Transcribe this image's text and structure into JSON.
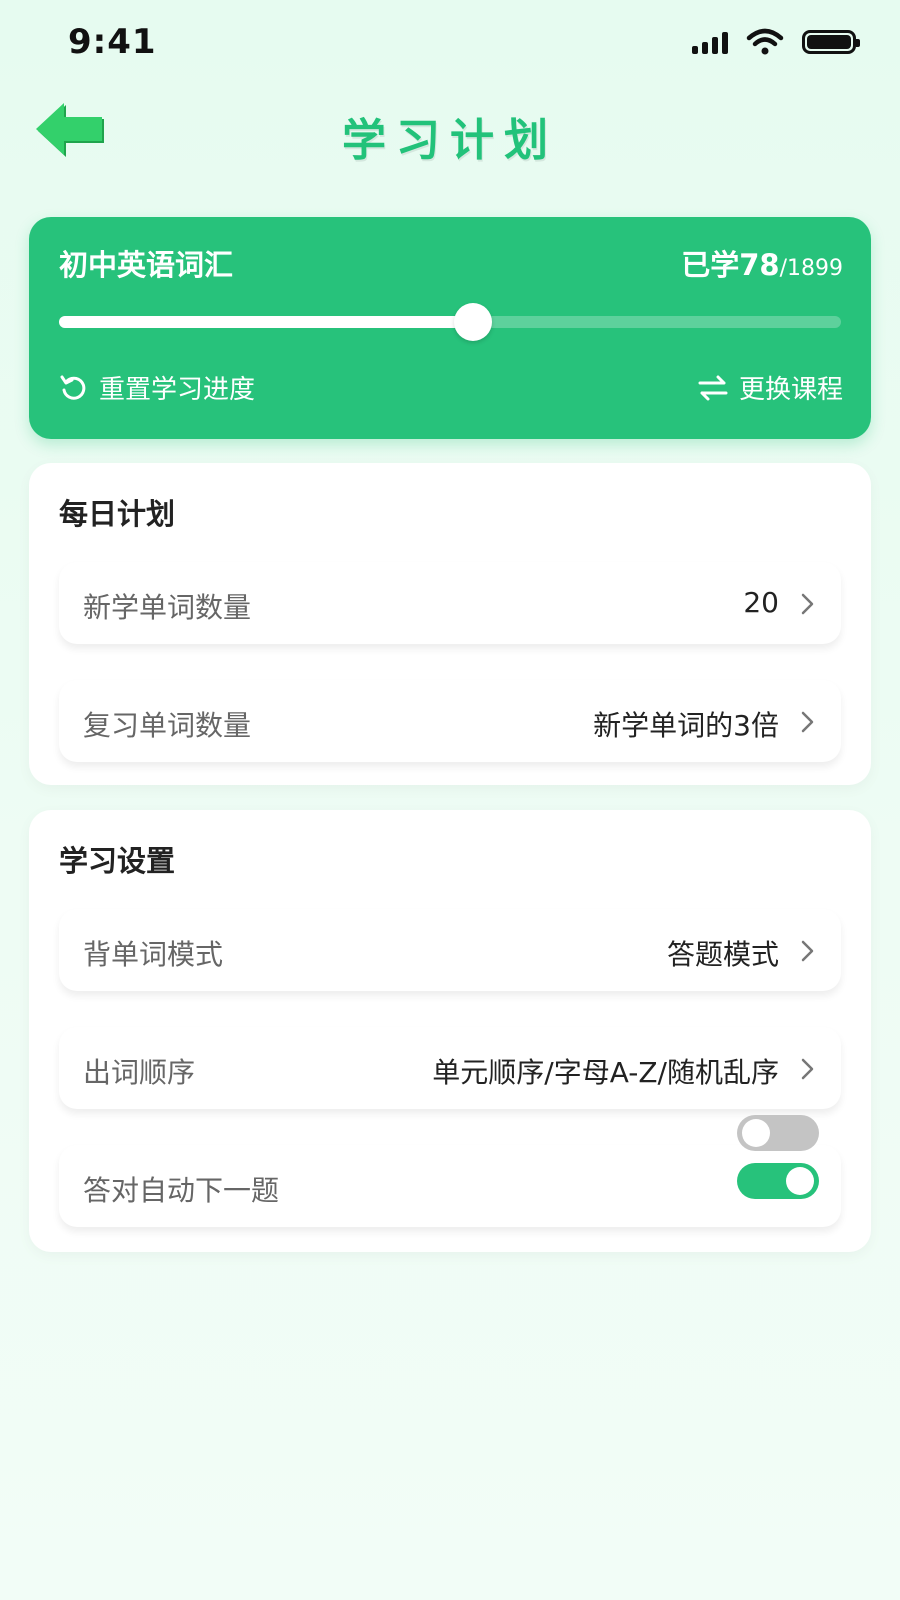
{
  "status_bar": {
    "time": "9:41"
  },
  "header": {
    "title": "学习计划"
  },
  "course": {
    "name": "初中英语词汇",
    "learned_prefix": "已学",
    "learned": "78",
    "total": "/1899",
    "progress_fraction": 0.53,
    "reset_label": "重置学习进度",
    "switch_label": "更换课程"
  },
  "daily_plan": {
    "title": "每日计划",
    "rows": [
      {
        "label": "新学单词数量",
        "value": "20"
      },
      {
        "label": "复习单词数量",
        "value": "新学单词的3倍"
      }
    ]
  },
  "study_settings": {
    "title": "学习设置",
    "rows": [
      {
        "label": "背单词模式",
        "value": "答题模式"
      },
      {
        "label": "出词顺序",
        "value": "单元顺序/字母A-Z/随机乱序"
      }
    ],
    "auto_next": {
      "label": "答对自动下一题",
      "toggle_upper": false,
      "toggle_lower": true
    }
  },
  "colors": {
    "accent": "#27c27b",
    "title": "#22c27a",
    "arrow": "#29c45c"
  },
  "icons": {
    "back": "green-arrow-left-icon",
    "reset": "refresh-icon",
    "switch": "swap-arrows-icon",
    "chevron": "chevron-right-icon"
  }
}
